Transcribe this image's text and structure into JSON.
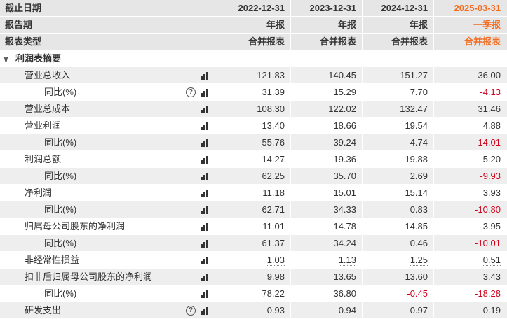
{
  "header": {
    "date_label": "截止日期",
    "period_label": "报告期",
    "type_label": "报表类型",
    "columns": [
      {
        "date": "2022-12-31",
        "period": "年报",
        "type": "合并报表"
      },
      {
        "date": "2023-12-31",
        "period": "年报",
        "type": "合并报表"
      },
      {
        "date": "2024-12-31",
        "period": "年报",
        "type": "合并报表"
      },
      {
        "date": "2025-03-31",
        "period": "一季报",
        "type": "合并报表"
      }
    ]
  },
  "section": {
    "title": "利润表摘要",
    "icon": "chevron-down-icon"
  },
  "rows": [
    {
      "label": "营业总收入",
      "sub": false,
      "help": false,
      "values": [
        "121.83",
        "140.45",
        "151.27",
        "36.00"
      ]
    },
    {
      "label": "同比(%)",
      "sub": true,
      "help": true,
      "values": [
        "31.39",
        "15.29",
        "7.70",
        "-4.13"
      ]
    },
    {
      "label": "营业总成本",
      "sub": false,
      "help": false,
      "values": [
        "108.30",
        "122.02",
        "132.47",
        "31.46"
      ]
    },
    {
      "label": "营业利润",
      "sub": false,
      "help": false,
      "values": [
        "13.40",
        "18.66",
        "19.54",
        "4.88"
      ]
    },
    {
      "label": "同比(%)",
      "sub": true,
      "help": false,
      "values": [
        "55.76",
        "39.24",
        "4.74",
        "-14.01"
      ]
    },
    {
      "label": "利润总额",
      "sub": false,
      "help": false,
      "values": [
        "14.27",
        "19.36",
        "19.88",
        "5.20"
      ]
    },
    {
      "label": "同比(%)",
      "sub": true,
      "help": false,
      "values": [
        "62.25",
        "35.70",
        "2.69",
        "-9.93"
      ]
    },
    {
      "label": "净利润",
      "sub": false,
      "help": false,
      "values": [
        "11.18",
        "15.01",
        "15.14",
        "3.93"
      ]
    },
    {
      "label": "同比(%)",
      "sub": true,
      "help": false,
      "values": [
        "62.71",
        "34.33",
        "0.83",
        "-10.80"
      ]
    },
    {
      "label": "归属母公司股东的净利润",
      "sub": false,
      "help": false,
      "values": [
        "11.01",
        "14.78",
        "14.85",
        "3.95"
      ]
    },
    {
      "label": "同比(%)",
      "sub": true,
      "help": false,
      "values": [
        "61.37",
        "34.24",
        "0.46",
        "-10.01"
      ]
    },
    {
      "label": "非经常性损益",
      "sub": false,
      "help": false,
      "underline": true,
      "values": [
        "1.03",
        "1.13",
        "1.25",
        "0.51"
      ]
    },
    {
      "label": "扣非后归属母公司股东的净利润",
      "sub": false,
      "help": false,
      "values": [
        "9.98",
        "13.65",
        "13.60",
        "3.43"
      ]
    },
    {
      "label": "同比(%)",
      "sub": true,
      "help": false,
      "values": [
        "78.22",
        "36.80",
        "-0.45",
        "-18.28"
      ]
    },
    {
      "label": "研发支出",
      "sub": false,
      "help": true,
      "values": [
        "0.93",
        "0.94",
        "0.97",
        "0.19"
      ]
    }
  ],
  "icons": {
    "chart": "bar-chart-icon",
    "help": "question-circle-icon"
  },
  "colors": {
    "accent": "#f36c21",
    "negative": "#d0021b",
    "header_bg": "#e6e6e6",
    "alt_row_bg": "#eeeeee"
  }
}
